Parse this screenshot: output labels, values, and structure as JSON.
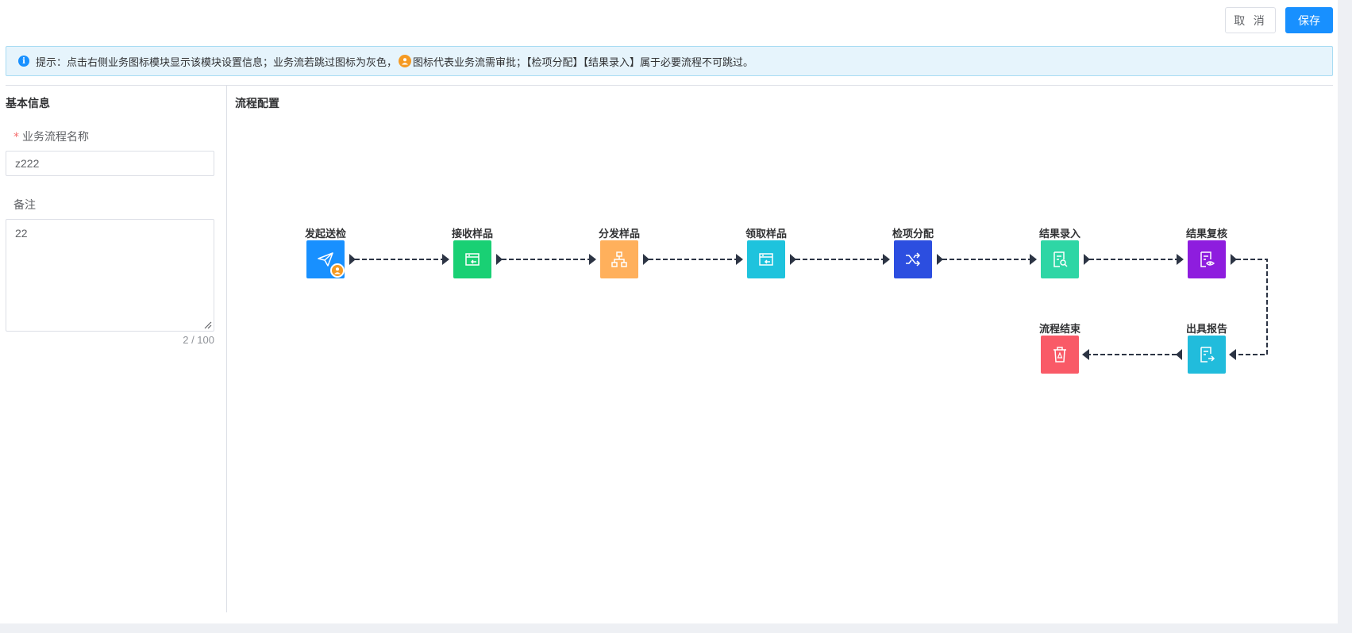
{
  "toolbar": {
    "cancel_label": "取 消",
    "save_label": "保存"
  },
  "tip": {
    "text_part1": "提示：点击右侧业务图标模块显示该模块设置信息；业务流若跳过图标为灰色，",
    "text_part2": "图标代表业务流需审批；【检项分配】【结果录入】属于必要流程不可跳过。"
  },
  "basic_info": {
    "title": "基本信息",
    "name_label": "业务流程名称",
    "name_value": "z222",
    "remark_label": "备注",
    "remark_value": "22",
    "counter": "2 / 100"
  },
  "flow_config": {
    "title": "流程配置",
    "nodes": [
      {
        "label": "发起送检",
        "color": "#1890ff",
        "icon": "send-icon"
      },
      {
        "label": "接收样品",
        "color": "#19d074",
        "icon": "receive-box-icon"
      },
      {
        "label": "分发样品",
        "color": "#ffb05c",
        "icon": "distribute-icon"
      },
      {
        "label": "领取样品",
        "color": "#1ec3dd",
        "icon": "collect-box-icon"
      },
      {
        "label": "检项分配",
        "color": "#2c4ee0",
        "icon": "shuffle-icon"
      },
      {
        "label": "结果录入",
        "color": "#2ed6a5",
        "icon": "document-search-icon"
      },
      {
        "label": "结果复核",
        "color": "#8e1dde",
        "icon": "document-eye-icon"
      },
      {
        "label": "出具报告",
        "color": "#21bcdc",
        "icon": "document-export-icon"
      },
      {
        "label": "流程结束",
        "color": "#f95a67",
        "icon": "trash-icon"
      }
    ]
  }
}
